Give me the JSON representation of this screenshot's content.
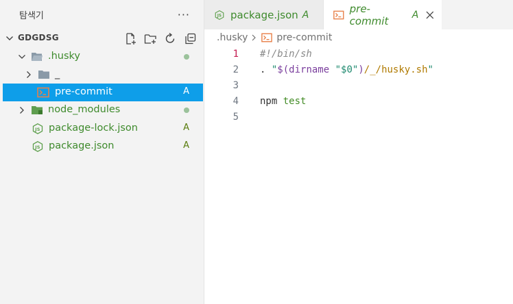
{
  "sidebar": {
    "title": "탐색기",
    "more": "···",
    "root": {
      "label": "GDGDSG"
    },
    "items": [
      {
        "label": ".husky",
        "type": "folder-open",
        "status": "dot"
      },
      {
        "label": "_",
        "type": "folder",
        "status": ""
      },
      {
        "label": "pre-commit",
        "type": "shell",
        "status": "A"
      },
      {
        "label": "node_modules",
        "type": "folder",
        "status": "dot"
      },
      {
        "label": "package-lock.json",
        "type": "js",
        "status": "A"
      },
      {
        "label": "package.json",
        "type": "js",
        "status": "A"
      }
    ]
  },
  "tabs": [
    {
      "label": "package.json",
      "badge": "A",
      "icon": "js-icon"
    },
    {
      "label": "pre-commit",
      "badge": "A",
      "icon": "shell-icon"
    }
  ],
  "breadcrumb": {
    "folder": ".husky",
    "file": "pre-commit"
  },
  "code": {
    "line_numbers": [
      "1",
      "2",
      "3",
      "4",
      "5"
    ],
    "line1": "#!/bin/sh",
    "line2": {
      "dot": ". ",
      "q1": "\"",
      "dollar": "$(",
      "cmd": "dirname",
      "sp": " ",
      "q2": "\"",
      "arg": "$0",
      "q3": "\"",
      "close": ")",
      "path": "/_/husky.sh",
      "q4": "\""
    },
    "line4": {
      "cmd": "npm",
      "sp": " ",
      "arg": "test"
    }
  },
  "colors": {
    "selection": "#0e9ee9",
    "git_added": "#3e8a2c",
    "active_line_number": "#c41a4f"
  }
}
